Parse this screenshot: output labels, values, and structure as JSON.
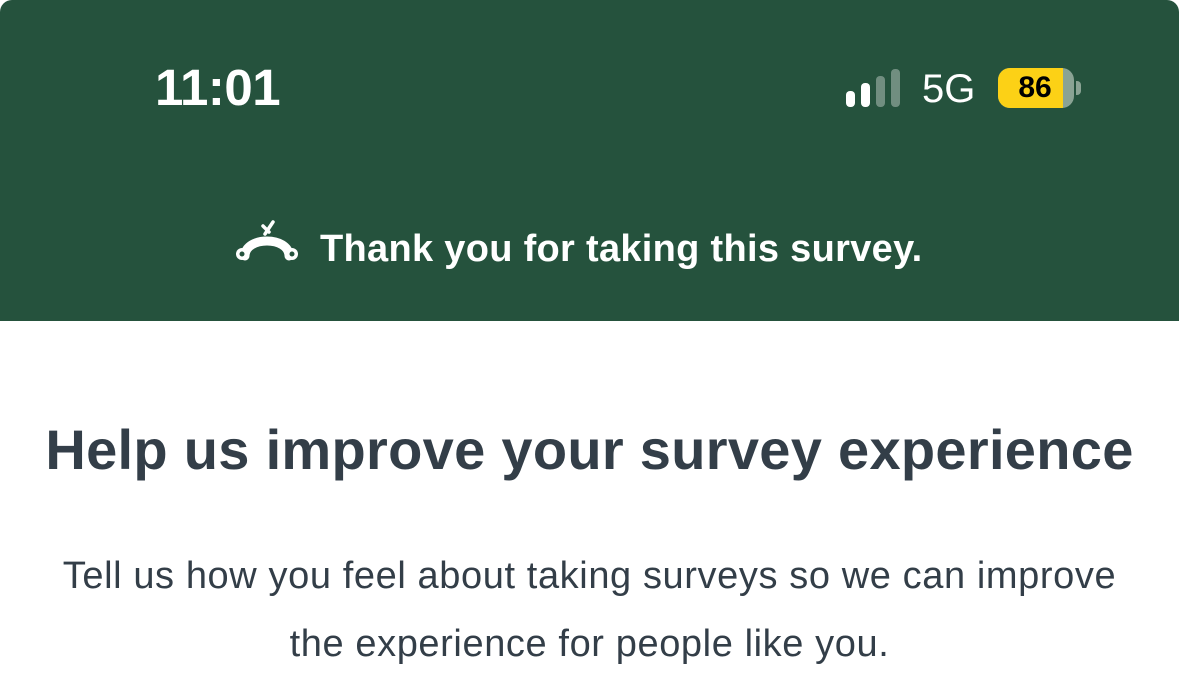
{
  "status_bar": {
    "time": "11:01",
    "network": "5G",
    "battery_level": "86",
    "signal_bars_active": 2,
    "signal_bars_total": 4,
    "battery_fraction": 0.86,
    "icons": [
      "signal-icon",
      "battery-icon"
    ]
  },
  "header": {
    "logo_icon": "surveymonkey-logo-icon",
    "message": "Thank you for taking this survey."
  },
  "main": {
    "title": "Help us improve your survey experience",
    "description": "Tell us how you feel about taking surveys so we can improve the experience for people like you."
  },
  "colors": {
    "header_bg": "#25523d",
    "text_dark": "#333e48",
    "battery_accent": "#fcd116"
  }
}
